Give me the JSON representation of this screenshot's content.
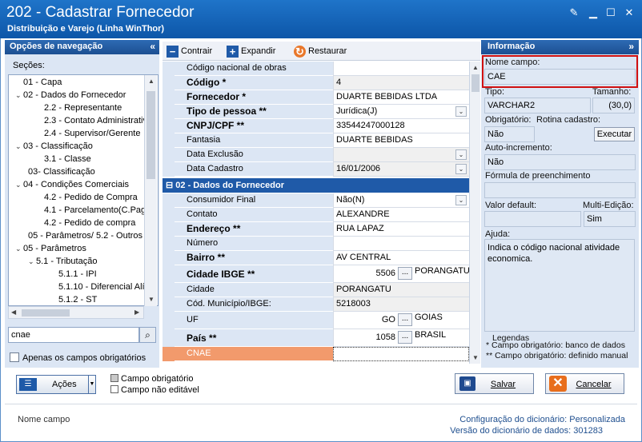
{
  "window": {
    "title": "202 - Cadastrar  Fornecedor",
    "subtitle": "Distribuição e Varejo (Linha WinThor)"
  },
  "nav": {
    "header": "Opções de navegação",
    "sections_label": "Seções:",
    "tree": [
      {
        "label": "01 - Capa",
        "toggle": ""
      },
      {
        "label": "02 - Dados do Fornecedor",
        "toggle": "v"
      },
      {
        "label": "2.2 - Representante",
        "toggle": ""
      },
      {
        "label": "2.3 - Contato Administrativ",
        "toggle": ""
      },
      {
        "label": "2.4 - Supervisor/Gerente",
        "toggle": ""
      },
      {
        "label": "03 - Classificação",
        "toggle": "v"
      },
      {
        "label": "3.1 - Classe",
        "toggle": ""
      },
      {
        "label": "03- Classificação",
        "toggle": ""
      },
      {
        "label": "04 - Condições Comerciais",
        "toggle": "v"
      },
      {
        "label": "4.2 - Pedido de Compra",
        "toggle": ""
      },
      {
        "label": "4.1 - Parcelamento(C.Paga",
        "toggle": ""
      },
      {
        "label": "4.2 - Pedido de compra",
        "toggle": ""
      },
      {
        "label": "05 - Parâmetros/ 5.2 - Outros",
        "toggle": ""
      },
      {
        "label": "05 - Parâmetros",
        "toggle": "v"
      },
      {
        "label": "5.1 - Tributação",
        "toggle": "v"
      },
      {
        "label": "5.1.1 - IPI",
        "toggle": ""
      },
      {
        "label": "5.1.10 - Diferencial Alí",
        "toggle": ""
      },
      {
        "label": "5.1.2 - ST",
        "toggle": ""
      }
    ],
    "search_value": "cnae",
    "only_required_label": "Apenas os campos obrigatórios"
  },
  "toolbar": {
    "collapse": "Contrair",
    "expand": "Expandir",
    "restore": "Restaurar"
  },
  "grid": {
    "rows": [
      {
        "label": "Código nacional de obras",
        "value": ""
      },
      {
        "label": "Código *",
        "value": "4"
      },
      {
        "label": "Fornecedor *",
        "value": "DUARTE BEBIDAS LTDA"
      },
      {
        "label": "Tipo de pessoa **",
        "value": "Jurídica(J)"
      },
      {
        "label": "CNPJ/CPF **",
        "value": "33544247000128"
      },
      {
        "label": "Fantasia",
        "value": "DUARTE BEBIDAS"
      },
      {
        "label": "Data Exclusão",
        "value": ""
      },
      {
        "label": "Data Cadastro",
        "value": "16/01/2006"
      }
    ],
    "section2": "02 - Dados do Fornecedor",
    "rows2": [
      {
        "label": "Consumidor Final",
        "value": "Não(N)"
      },
      {
        "label": "Contato",
        "value": "ALEXANDRE"
      },
      {
        "label": "Endereço **",
        "value": "RUA LAPAZ"
      },
      {
        "label": "Número",
        "value": ""
      },
      {
        "label": "Bairro **",
        "value": "AV CENTRAL"
      },
      {
        "label": "Cidade IBGE **",
        "value": "5506",
        "extra": "PORANGATU"
      },
      {
        "label": "Cidade",
        "value": "PORANGATU"
      },
      {
        "label": "Cód. Município/IBGE:",
        "value": "5218003"
      },
      {
        "label": "UF",
        "value": "GO",
        "extra": "GOIAS"
      },
      {
        "label": "País **",
        "value": "1058",
        "extra": "BRASIL"
      },
      {
        "label": "CNAE",
        "value": ""
      }
    ],
    "ellipsis": "..."
  },
  "info": {
    "header": "Informação",
    "field_name_label": "Nome campo:",
    "field_name": "CAE",
    "type_label": "Tipo:",
    "type": "VARCHAR2",
    "size_label": "Tamanho:",
    "size": "(30,0)",
    "required_label": "Obrigatório:",
    "required": "Não",
    "routine_label": "Rotina cadastro:",
    "execute": "Executar",
    "autoinc_label": "Auto-incremento:",
    "autoinc": "Não",
    "formula_label": "Fórmula de preenchimento",
    "formula": "",
    "default_label": "Valor default:",
    "default": "",
    "multiedit_label": "Multi-Edição:",
    "multiedit": "Sim",
    "help_label": "Ajuda:",
    "help": "Indica o código nacional atividade economica.",
    "legend_title": "Legendas",
    "legend1": "* Campo obrigatório: banco de dados",
    "legend2": "** Campo obrigatório: definido manual"
  },
  "bottom": {
    "actions": "Ações",
    "required_field": "Campo obrigatório",
    "readonly_field": "Campo não editável",
    "save": "Salvar",
    "cancel": "Cancelar"
  },
  "status": {
    "left": "Nome campo",
    "config_label": "Configuração do dicionário:",
    "config_value": "Personalizada",
    "version_label": "Versão do dicionário de dados:",
    "version_value": "301283"
  },
  "colors": {
    "title_bar": "#1565c0",
    "panel_header": "#1f5aa8",
    "highlight": "#d01010",
    "cnae_row": "#f29a6c"
  }
}
